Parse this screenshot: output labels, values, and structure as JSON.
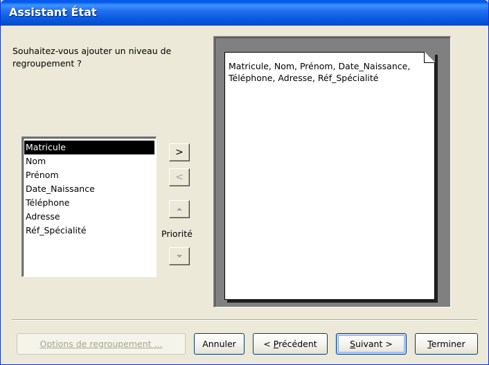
{
  "window": {
    "title": "Assistant État"
  },
  "prompt": "Souhaitez-vous ajouter un niveau de regroupement ?",
  "fields": [
    {
      "label": "Matricule",
      "selected": true
    },
    {
      "label": "Nom",
      "selected": false
    },
    {
      "label": "Prénom",
      "selected": false
    },
    {
      "label": "Date_Naissance",
      "selected": false
    },
    {
      "label": "Téléphone",
      "selected": false
    },
    {
      "label": "Adresse",
      "selected": false
    },
    {
      "label": "Réf_Spécialité",
      "selected": false
    }
  ],
  "buttons": {
    "add": ">",
    "remove": "<",
    "priority_label": "Priorité",
    "options": "Options de regroupement ...",
    "cancel": "Annuler",
    "previous_prefix": "< ",
    "previous_access": "P",
    "previous_rest": "récédent",
    "next_access": "S",
    "next_rest": "uivant >",
    "finish_access": "T",
    "finish_rest": "erminer"
  },
  "preview": {
    "text": "Matricule, Nom, Prénom, Date_Naissance, Téléphone, Adresse, Réf_Spécialité"
  },
  "icons": [
    "move-up-icon",
    "move-down-icon",
    "page-fold-icon"
  ],
  "colors": {
    "titlebar": "#0058ee",
    "window_bg": "#ece9d8",
    "selection": "#000000",
    "preview_bg": "#808080"
  }
}
